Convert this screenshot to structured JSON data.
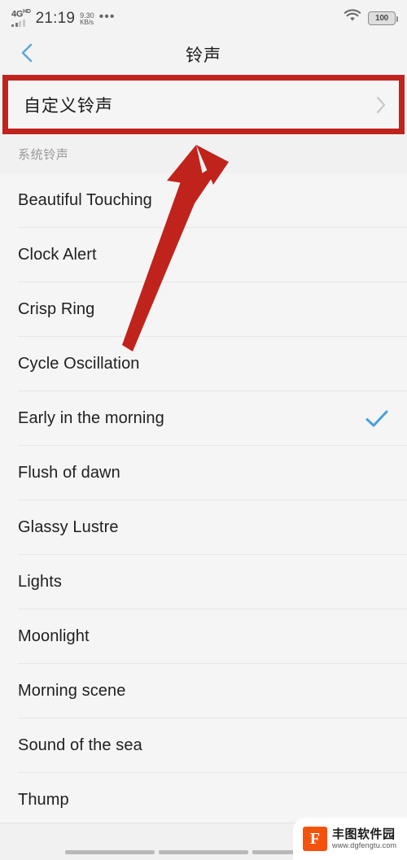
{
  "status_bar": {
    "network_type": "4G",
    "network_type_sup": "HD",
    "time": "21:19",
    "data_rate_value": "9.30",
    "data_rate_unit": "KB/s",
    "overflow": "•••",
    "wifi_icon": "wifi-icon",
    "battery_level": "100"
  },
  "title_bar": {
    "back_icon": "chevron-left-icon",
    "title": "铃声",
    "back_color": "#5aa6dd"
  },
  "custom_ringtone": {
    "label": "自定义铃声",
    "chevron_icon": "chevron-right-icon",
    "highlight_color": "#c0231c"
  },
  "section": {
    "header": "系统铃声"
  },
  "ringtones": [
    {
      "name": "Beautiful Touching",
      "selected": false
    },
    {
      "name": "Clock Alert",
      "selected": false
    },
    {
      "name": "Crisp Ring",
      "selected": false
    },
    {
      "name": "Cycle Oscillation",
      "selected": false
    },
    {
      "name": "Early in the morning",
      "selected": true
    },
    {
      "name": "Flush of dawn",
      "selected": false
    },
    {
      "name": "Glassy Lustre",
      "selected": false
    },
    {
      "name": "Lights",
      "selected": false
    },
    {
      "name": "Moonlight",
      "selected": false
    },
    {
      "name": "Morning scene",
      "selected": false
    },
    {
      "name": "Sound of the sea",
      "selected": false
    },
    {
      "name": "Thump",
      "selected": false
    }
  ],
  "selected_check": {
    "icon": "check-icon",
    "color": "#4a9fd8"
  },
  "annotation": {
    "arrow_icon": "arrow-up-right-icon",
    "arrow_color": "#c0231c"
  },
  "watermark": {
    "logo_glyph": "F",
    "site_name": "丰图软件园",
    "site_url": "www.dgfengtu.com",
    "brand_color": "#f4530f"
  },
  "nav_bar": {
    "segments": [
      "nav-back",
      "nav-home",
      "nav-recents"
    ]
  }
}
